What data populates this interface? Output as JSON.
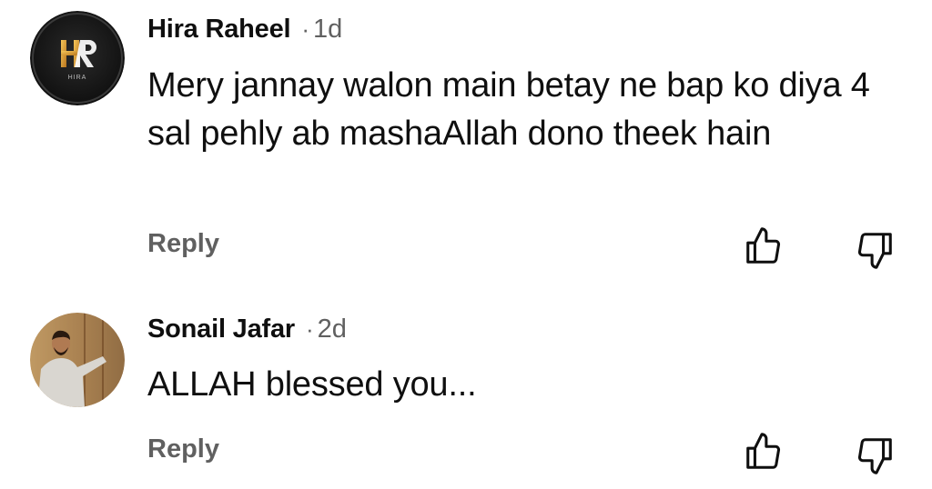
{
  "comments": [
    {
      "author": "Hira Raheel",
      "separator": "·",
      "time": "1d",
      "text": "Mery jannay walon main betay ne bap ko diya 4 sal pehly ab mashaAllah dono theek hain",
      "reply_label": "Reply",
      "avatar_text": "HIRA",
      "avatar_initials": "HR"
    },
    {
      "author": "Sonail Jafar",
      "separator": "·",
      "time": "2d",
      "text": "ALLAH blessed you...",
      "reply_label": "Reply"
    }
  ],
  "icons": {
    "like": "thumbs-up-icon",
    "dislike": "thumbs-down-icon"
  },
  "colors": {
    "primary_text": "#0f0f0f",
    "secondary_text": "#606060",
    "background": "#ffffff"
  }
}
